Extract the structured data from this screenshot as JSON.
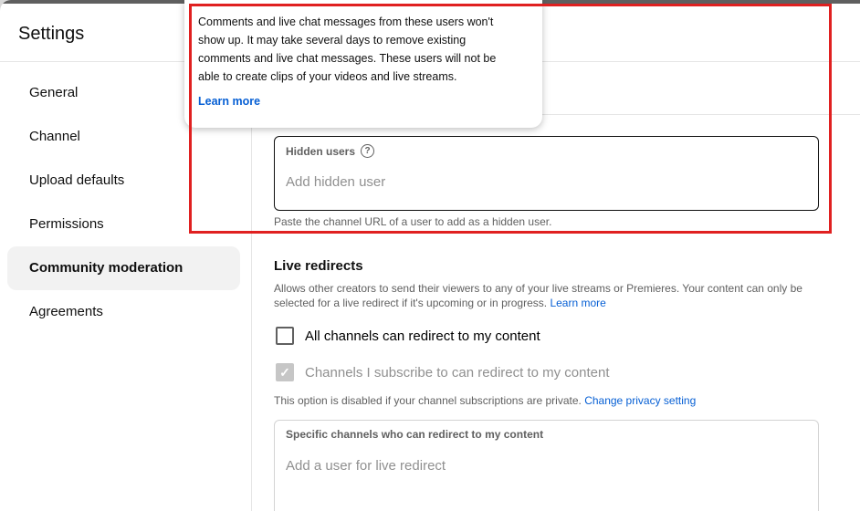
{
  "header": {
    "title": "Settings"
  },
  "sidebar": {
    "items": [
      {
        "label": "General",
        "active": false
      },
      {
        "label": "Channel",
        "active": false
      },
      {
        "label": "Upload defaults",
        "active": false
      },
      {
        "label": "Permissions",
        "active": false
      },
      {
        "label": "Community moderation",
        "active": true
      },
      {
        "label": "Agreements",
        "active": false
      }
    ]
  },
  "tooltip": {
    "text": "Comments and live chat messages from these users won't show up. It may take several days to remove existing comments and live chat messages. These users will not be able to create clips of your videos and live streams.",
    "learn_more": "Learn more"
  },
  "hidden_users": {
    "label": "Hidden users",
    "help_icon": "help-circle-icon",
    "placeholder": "Add hidden user",
    "helper": "Paste the channel URL of a user to add as a hidden user."
  },
  "live_redirects": {
    "title": "Live redirects",
    "description": "Allows other creators to send their viewers to any of your live streams or Premieres. Your content can only be selected for a live redirect if it's upcoming or in progress.",
    "learn_more": "Learn more",
    "option_all": {
      "label": "All channels can redirect to my content",
      "checked": false
    },
    "option_subscribed": {
      "label": "Channels I subscribe to can redirect to my content",
      "checked": true,
      "disabled": true
    },
    "disabled_note": "This option is disabled if your channel subscriptions are private.",
    "change_privacy": "Change privacy setting",
    "specific_label": "Specific channels who can redirect to my content",
    "specific_placeholder": "Add a user for live redirect"
  },
  "colors": {
    "accent_link": "#065fd4",
    "highlight": "#e02020"
  }
}
